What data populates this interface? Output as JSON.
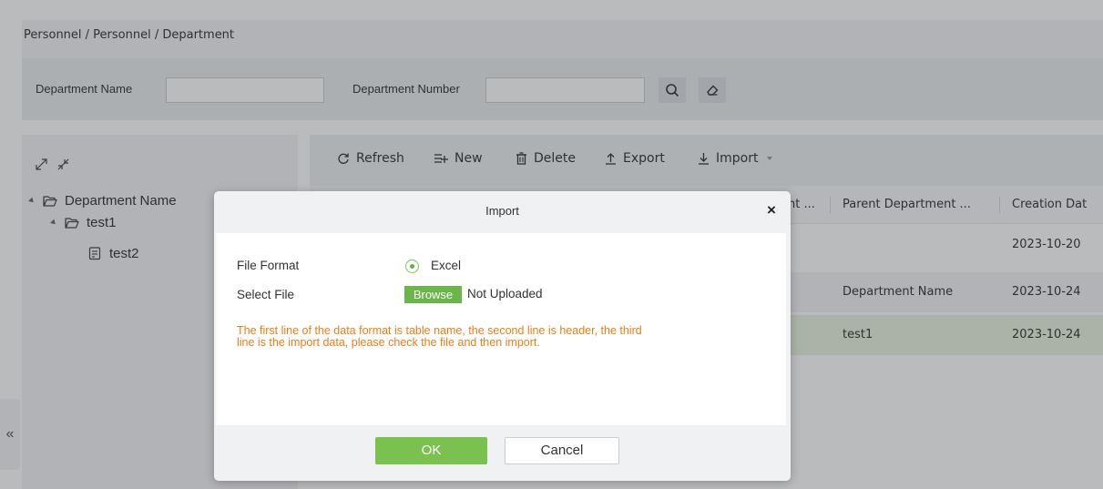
{
  "breadcrumb": "Personnel / Personnel / Department",
  "search": {
    "dept_name_label": "Department Name",
    "dept_name_value": "",
    "dept_number_label": "Department Number",
    "dept_number_value": "",
    "search_icon": "search-icon",
    "clear_icon": "eraser-icon"
  },
  "tree": {
    "expand_icons": [
      "expand-all-icon",
      "collapse-all-icon"
    ],
    "nodes": [
      {
        "label": "Department Name",
        "icon": "folder-open-icon"
      },
      {
        "label": "test1",
        "icon": "folder-open-icon"
      },
      {
        "label": "test2",
        "icon": "document-icon"
      }
    ],
    "collapse_label": "«"
  },
  "toolbar": {
    "refresh": "Refresh",
    "new": "New",
    "delete": "Delete",
    "export": "Export",
    "import": "Import"
  },
  "table": {
    "columns": [
      "nt ...",
      "Parent Department ...",
      "Creation Dat"
    ],
    "rows": [
      {
        "parent": "",
        "created": "2023-10-20"
      },
      {
        "parent": "Department Name",
        "created": "2023-10-24"
      },
      {
        "parent": "test1",
        "created": "2023-10-24"
      }
    ]
  },
  "modal": {
    "title": "Import",
    "close": "×",
    "file_format_label": "File Format",
    "file_format_value": "Excel",
    "select_file_label": "Select File",
    "browse": "Browse",
    "upload_status": "Not Uploaded",
    "warning_line1": "The first line of the data format is table name, the second line is header, the third",
    "warning_line2": "line is the import data, please check the file and then import.",
    "ok": "OK",
    "cancel": "Cancel"
  },
  "colors": {
    "accent_green": "#7ac14f",
    "warning_orange": "#ef7d1a",
    "row_highlight": "#e9f3e0"
  }
}
